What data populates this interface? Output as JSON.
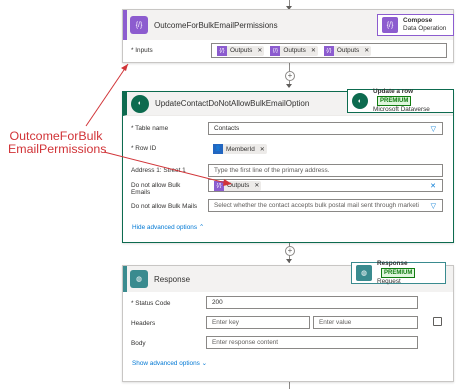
{
  "compose_card": {
    "title": "OutcomeForBulkEmailPermissions",
    "side_title": "Compose",
    "side_subtitle": "Data Operation",
    "inputs_label": "* Inputs",
    "tokens": [
      "Outputs",
      "Outputs",
      "Outputs"
    ]
  },
  "update_card": {
    "title": "UpdateContactDoNotAllowBulkEmailOption",
    "side_title": "Update a row",
    "side_badge": "PREMIUM",
    "side_subtitle": "Microsoft Dataverse",
    "table_label": "* Table name",
    "table_value": "Contacts",
    "rowid_label": "* Row ID",
    "rowid_token": "MemberId",
    "street_label": "Address 1: Street 1",
    "street_placeholder": "Type the first line of the primary address.",
    "dna_email_label": "Do not allow Bulk Emails",
    "dna_email_token": "Outputs",
    "dna_mail_label": "Do not allow Bulk Mails",
    "dna_mail_placeholder": "Select whether the contact accepts bulk postal mail sent through marketi",
    "hide_advanced": "Hide advanced options"
  },
  "response_card": {
    "title": "Response",
    "side_title": "Response",
    "side_badge": "PREMIUM",
    "side_subtitle": "Request",
    "status_label": "* Status Code",
    "status_value": "200",
    "headers_label": "Headers",
    "key_placeholder": "Enter key",
    "value_placeholder": "Enter value",
    "body_label": "Body",
    "body_placeholder": "Enter response content",
    "show_advanced": "Show advanced options"
  },
  "callout": {
    "line1": "OutcomeForBulk",
    "line2": "EmailPermissions",
    "color": "#d13438"
  },
  "colors": {
    "compose_purple": "#8c5ccf",
    "dataverse_green": "#0d6b4f",
    "response_teal": "#3a8b8f",
    "link_blue": "#0078d4"
  }
}
